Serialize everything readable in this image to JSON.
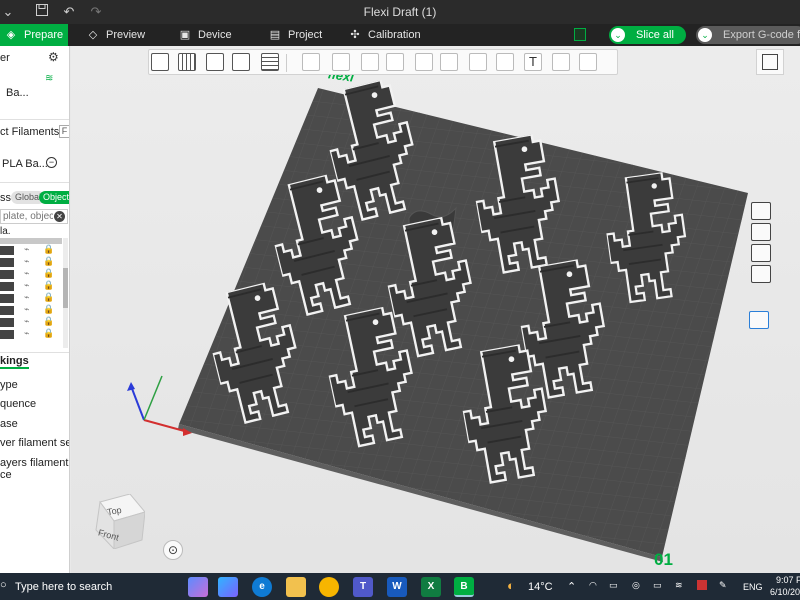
{
  "window": {
    "title": "Flexi Draft (1)"
  },
  "tabs": [
    {
      "label": "Prepare",
      "icon": "cube-icon",
      "active": true
    },
    {
      "label": "Preview",
      "icon": "layers-icon",
      "active": false
    },
    {
      "label": "Device",
      "icon": "device-icon",
      "active": false
    },
    {
      "label": "Project",
      "icon": "project-icon",
      "active": false
    },
    {
      "label": "Calibration",
      "icon": "calibration-icon",
      "active": false
    }
  ],
  "actions": {
    "slice_label": "Slice all",
    "export_label": "Export G-code fil"
  },
  "left_panel": {
    "printer_header": "er",
    "printer_name": "Ba...",
    "filaments_header": "ct Filaments",
    "filament_badge": "F",
    "filament_name": "PLA Ba...",
    "process_label": "ss",
    "process_tab_global": "Global",
    "process_tab_objects": "Objects",
    "search_placeholder": "plate, objec",
    "column_header": "la.",
    "settings_header": "kings",
    "settings_items": [
      "ype",
      "quence",
      "ase",
      "ver filament seq",
      "ayers filament",
      "ce"
    ]
  },
  "canvas": {
    "brand_mark": "flexi",
    "plate_number": "01",
    "viewcube_top": "Top",
    "viewcube_front": "Front"
  },
  "taskbar": {
    "search_placeholder": "Type here to search",
    "weather": "14°C",
    "language": "ENG",
    "time": "9:07 P",
    "date": "6/10/20"
  },
  "colors": {
    "accent": "#00ae42",
    "plate": "#4b4b4b",
    "model": "#3c3c3c"
  }
}
